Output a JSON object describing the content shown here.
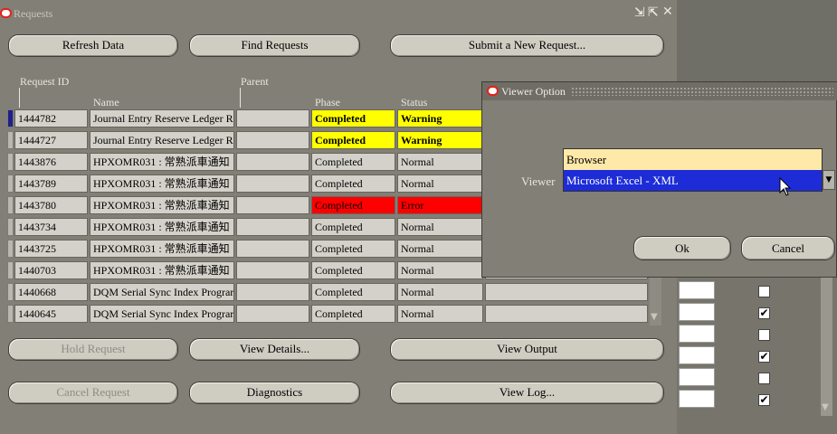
{
  "window": {
    "title": "Requests"
  },
  "toolbar": {
    "refresh_label": "Refresh Data",
    "find_label": "Find Requests",
    "submit_label": "Submit a New Request..."
  },
  "table": {
    "headers": {
      "request_id": "Request ID",
      "parent": "Parent",
      "name": "Name",
      "phase": "Phase",
      "status": "Status"
    },
    "rows": [
      {
        "id": "1444782",
        "name": "Journal Entry Reserve Ledger Re",
        "parent": "",
        "phase": "Completed",
        "status": "Warning",
        "tone": "yellow"
      },
      {
        "id": "1444727",
        "name": "Journal Entry Reserve Ledger Re",
        "parent": "",
        "phase": "Completed",
        "status": "Warning",
        "tone": "yellow"
      },
      {
        "id": "1443876",
        "name": "HPXOMR031 : 常熟派車通知",
        "parent": "",
        "phase": "Completed",
        "status": "Normal",
        "tone": "normal"
      },
      {
        "id": "1443789",
        "name": "HPXOMR031 : 常熟派車通知",
        "parent": "",
        "phase": "Completed",
        "status": "Normal",
        "tone": "normal"
      },
      {
        "id": "1443780",
        "name": "HPXOMR031 : 常熟派車通知",
        "parent": "",
        "phase": "Completed",
        "status": "Error",
        "tone": "red"
      },
      {
        "id": "1443734",
        "name": "HPXOMR031 : 常熟派車通知",
        "parent": "",
        "phase": "Completed",
        "status": "Normal",
        "tone": "normal"
      },
      {
        "id": "1443725",
        "name": "HPXOMR031 : 常熟派車通知",
        "parent": "",
        "phase": "Completed",
        "status": "Normal",
        "tone": "normal"
      },
      {
        "id": "1440703",
        "name": "HPXOMR031 : 常熟派車通知",
        "parent": "",
        "phase": "Completed",
        "status": "Normal",
        "tone": "normal"
      },
      {
        "id": "1440668",
        "name": "DQM Serial Sync Index Prograr",
        "parent": "",
        "phase": "Completed",
        "status": "Normal",
        "tone": "normal"
      },
      {
        "id": "1440645",
        "name": "DQM Serial Sync Index Prograr",
        "parent": "",
        "phase": "Completed",
        "status": "Normal",
        "tone": "normal"
      }
    ]
  },
  "bottom": {
    "hold_label": "Hold Request",
    "view_details_label": "View Details...",
    "view_output_label": "View Output",
    "cancel_request_label": "Cancel Request",
    "diagnostics_label": "Diagnostics",
    "view_log_label": "View Log..."
  },
  "right_panel": {
    "checkbox_states": [
      false,
      true,
      false,
      true,
      false,
      true
    ]
  },
  "dialog": {
    "title": "Viewer Option",
    "viewer_label": "Viewer",
    "options": [
      "Browser",
      "Microsoft Excel - XML"
    ],
    "selected_option": "Microsoft Excel - XML",
    "ok_label": "Ok",
    "cancel_label": "Cancel"
  },
  "icons": {
    "window_controls": [
      "minimize-icon",
      "restore-icon",
      "close-icon"
    ],
    "app_icon": "oracle-icon",
    "cursor": "mouse-pointer-icon"
  },
  "colors": {
    "warning": "#ffff00",
    "error": "#ff0000",
    "selection": "#1d2cd7",
    "hover": "#ffe9a8",
    "window_bg": "#827f76"
  }
}
